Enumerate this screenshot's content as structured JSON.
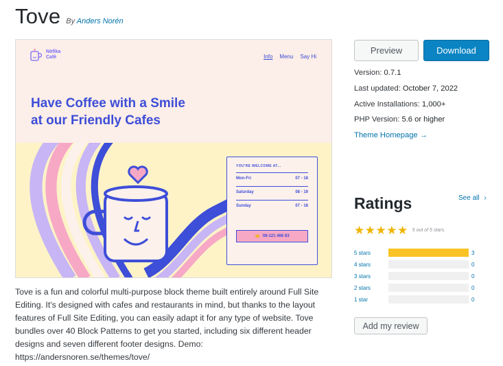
{
  "theme": {
    "title": "Tove",
    "by_prefix": "By",
    "author": "Anders Norén"
  },
  "screenshot": {
    "brand_line1": "Nöfika",
    "brand_line2": "Café",
    "nav": [
      "Info",
      "Menu",
      "Say Hi"
    ],
    "headline_line1": "Have Coffee with a Smile",
    "headline_line2": "at our Friendly Cafes",
    "hours_heading": "YOU'RE WELCOME AT...",
    "hours": [
      {
        "day": "Mon-Fri",
        "time": "07 - 18"
      },
      {
        "day": "Saturday",
        "time": "08 - 19"
      },
      {
        "day": "Sunday",
        "time": "07 - 18"
      }
    ],
    "phone": "08-121 466 83",
    "colors": {
      "accent": "#3d4ed8",
      "pink": "#f7a8c5",
      "purple": "#c7b5f5",
      "yellow": "#fdf3c7"
    }
  },
  "description": "Tove is a fun and colorful multi-purpose block theme built entirely around Full Site Editing. It's designed with cafes and restaurants in mind, but thanks to the layout features of Full Site Editing, you can easily adapt it for any type of website. Tove bundles over 40 Block Patterns to get you started, including six different header designs and seven different footer designs. Demo: https://andersnoren.se/themes/tove/",
  "actions": {
    "preview": "Preview",
    "download": "Download"
  },
  "meta": {
    "version_label": "Version:",
    "version": "0.7.1",
    "updated_label": "Last updated:",
    "updated": "October 7, 2022",
    "installs_label": "Active Installations:",
    "installs": "1,000+",
    "php_label": "PHP Version:",
    "php": "5.6 or higher",
    "homepage": "Theme Homepage →"
  },
  "ratings": {
    "title": "Ratings",
    "see_all": "See all",
    "summary": "5 out of 5 stars.",
    "stars_value": 5,
    "rows": [
      {
        "label": "5 stars",
        "count": "3",
        "fraction": 1.0
      },
      {
        "label": "4 stars",
        "count": "0",
        "fraction": 0
      },
      {
        "label": "3 stars",
        "count": "0",
        "fraction": 0
      },
      {
        "label": "2 stars",
        "count": "0",
        "fraction": 0
      },
      {
        "label": "1 star",
        "count": "0",
        "fraction": 0
      }
    ],
    "add_review": "Add my review"
  }
}
